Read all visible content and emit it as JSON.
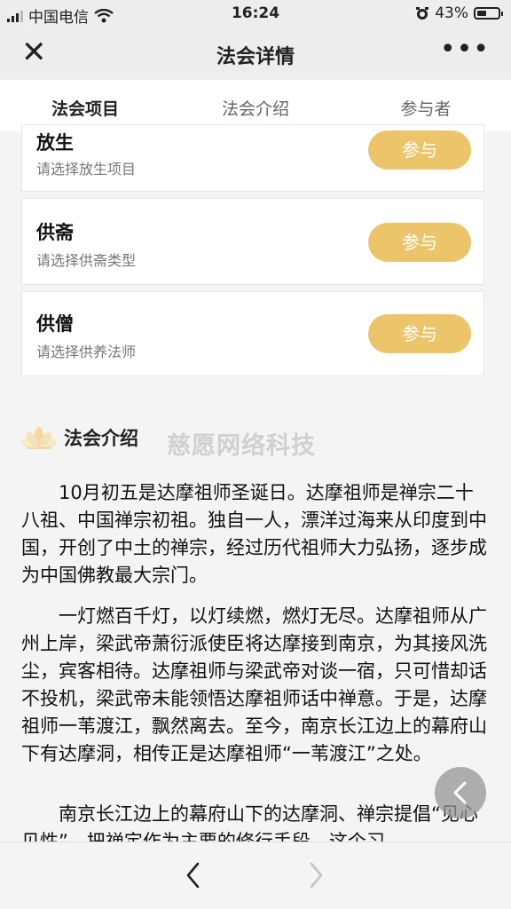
{
  "status_bar": {
    "carrier": "中国电信",
    "time": "16:24",
    "battery": "43%"
  },
  "navbar": {
    "title": "法会详情"
  },
  "tabs": [
    {
      "label": "法会项目"
    },
    {
      "label": "法会介绍"
    },
    {
      "label": "参与者"
    }
  ],
  "projects": [
    {
      "name": "放生",
      "hint": "请选择放生项目",
      "button": "参与"
    },
    {
      "name": "供斋",
      "hint": "请选择供斋类型",
      "button": "参与"
    },
    {
      "name": "供僧",
      "hint": "请选择供养法师",
      "button": "参与"
    }
  ],
  "intro": {
    "title": "法会介绍",
    "watermark": "慈愿网络科技",
    "paragraphs": [
      "10月初五是达摩祖师圣诞日。达摩祖师是禅宗二十八祖、中国禅宗初祖。独自一人，漂洋过海来从印度到中国，开创了中土的禅宗，经过历代祖师大力弘扬，逐步成为中国佛教最大宗门。",
      "一灯燃百千灯，以灯续燃，燃灯无尽。达摩祖师从广州上岸，梁武帝萧衍派使臣将达摩接到南京，为其接风洗尘，宾客相待。达摩祖师与梁武帝对谈一宿，只可惜却话不投机，梁武帝未能领悟达摩祖师话中禅意。于是，达摩祖师一苇渡江，飘然离去。至今，南京长江边上的幕府山下有达摩洞，相传正是达摩祖师“一苇渡江”之处。",
      "南京长江边上的幕府山下的达摩洞、禅宗提倡“见心见性”，把禅定作为主要的修行手段，这个习"
    ]
  },
  "icons": {
    "close": "close-icon",
    "more": "more-icon",
    "lotus": "lotus-icon",
    "back_fab": "chevron-left-icon",
    "nav_back": "nav-back-icon",
    "nav_forward": "nav-forward-icon",
    "wifi": "wifi-icon",
    "signal": "signal-icon",
    "alarm": "alarm-icon",
    "battery": "battery-icon"
  },
  "colors": {
    "accent": "#ecc56a",
    "tab_underline": "#e8c46a"
  }
}
